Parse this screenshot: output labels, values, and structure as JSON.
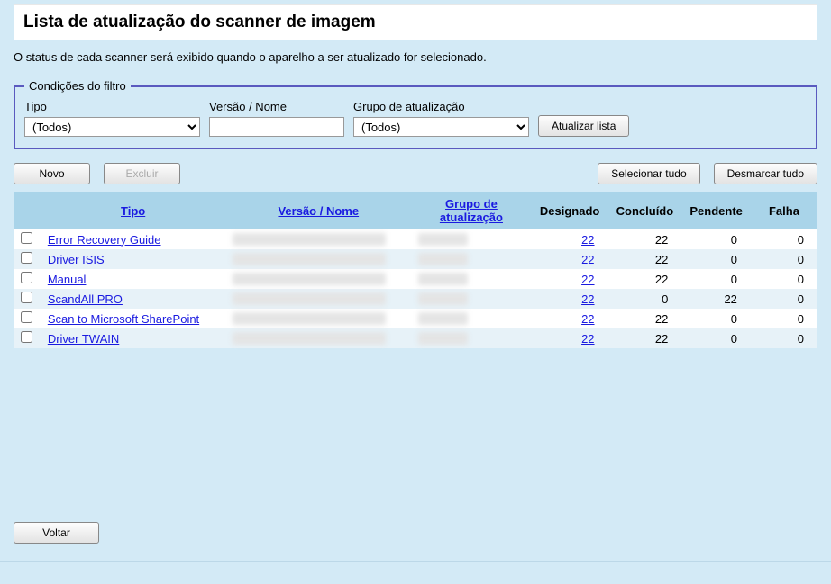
{
  "title": "Lista de atualização do scanner de imagem",
  "description": "O status de cada scanner será exibido quando o aparelho a ser atualizado for selecionado.",
  "filters": {
    "legend": "Condições do filtro",
    "type_label": "Tipo",
    "type_value": "(Todos)",
    "version_label": "Versão / Nome",
    "version_value": "",
    "group_label": "Grupo de atualização",
    "group_value": "(Todos)",
    "update_button": "Atualizar lista"
  },
  "actions": {
    "new": "Novo",
    "delete": "Excluir",
    "select_all": "Selecionar tudo",
    "deselect_all": "Desmarcar tudo"
  },
  "headers": {
    "type": "Tipo",
    "version": "Versão / Nome",
    "group": "Grupo de atualização",
    "assigned": "Designado",
    "completed": "Concluído",
    "pending": "Pendente",
    "failed": "Falha"
  },
  "rows": [
    {
      "type": "Error Recovery Guide",
      "assigned": "22",
      "completed": "22",
      "pending": "0",
      "failed": "0"
    },
    {
      "type": "Driver ISIS",
      "assigned": "22",
      "completed": "22",
      "pending": "0",
      "failed": "0"
    },
    {
      "type": "Manual",
      "assigned": "22",
      "completed": "22",
      "pending": "0",
      "failed": "0"
    },
    {
      "type": "ScandAll PRO",
      "assigned": "22",
      "completed": "0",
      "pending": "22",
      "failed": "0"
    },
    {
      "type": "Scan to Microsoft SharePoint",
      "assigned": "22",
      "completed": "22",
      "pending": "0",
      "failed": "0"
    },
    {
      "type": "Driver TWAIN",
      "assigned": "22",
      "completed": "22",
      "pending": "0",
      "failed": "0"
    }
  ],
  "back_button": "Voltar"
}
